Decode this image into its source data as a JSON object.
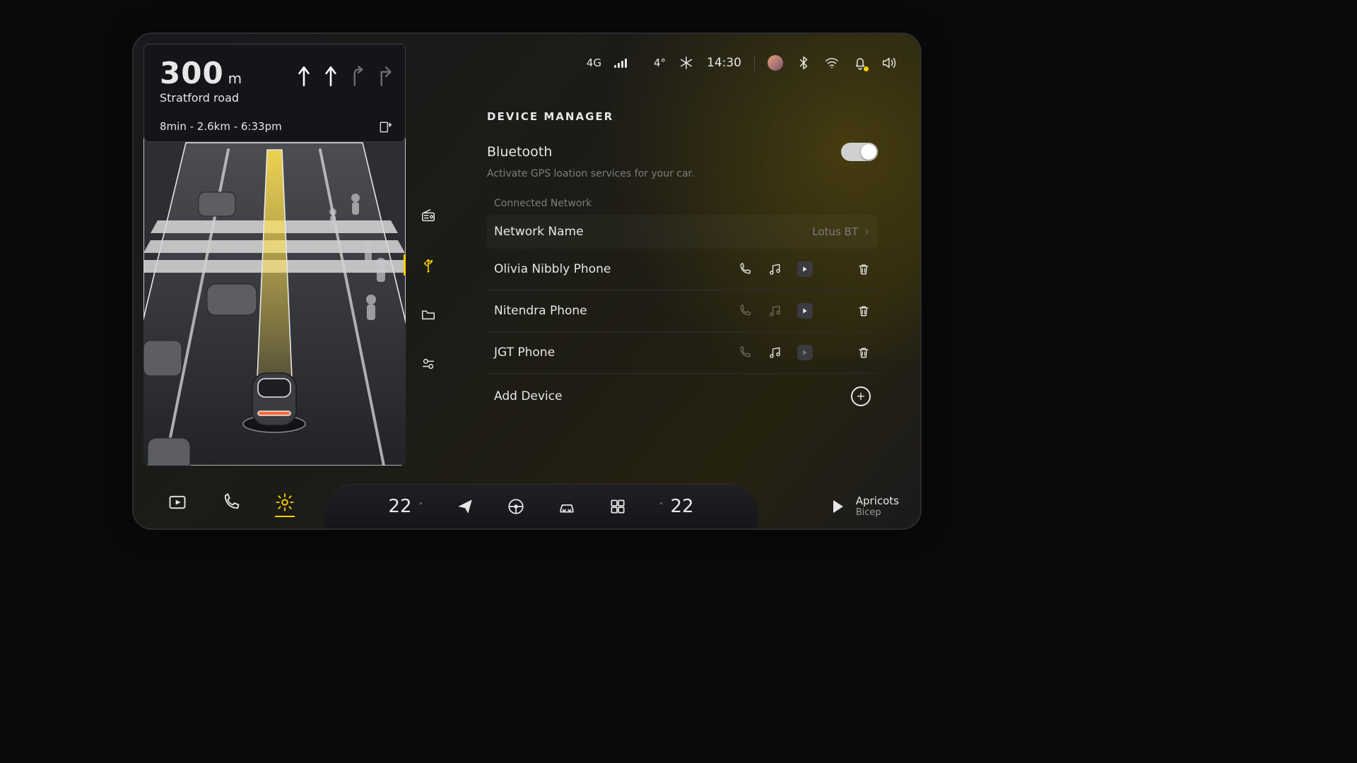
{
  "status": {
    "cell": "4G",
    "temp": "4°",
    "weather_icon": "snow-icon",
    "time": "14:30"
  },
  "nav": {
    "distance_value": "300",
    "distance_unit": "m",
    "street": "Stratford road",
    "eta": "8min - 2.6km - 6:33pm"
  },
  "device_manager": {
    "title": "DEVICE MANAGER",
    "bluetooth_label": "Bluetooth",
    "bluetooth_on": true,
    "bluetooth_desc": "Activate GPS loation services for your car.",
    "connected_label": "Connected Network",
    "network_label": "Network Name",
    "network_value": "Lotus BT",
    "devices": [
      {
        "name": "Olivia Nibbly Phone",
        "phone": true,
        "music": true,
        "carplay": true
      },
      {
        "name": "Nitendra Phone",
        "phone": false,
        "music": false,
        "carplay": true
      },
      {
        "name": "JGT Phone",
        "phone": false,
        "music": true,
        "carplay": false
      }
    ],
    "add_label": "Add Device"
  },
  "dock": {
    "left_temp": "22",
    "right_temp": "22"
  },
  "media": {
    "title": "Apricots",
    "artist": "Bicep"
  }
}
